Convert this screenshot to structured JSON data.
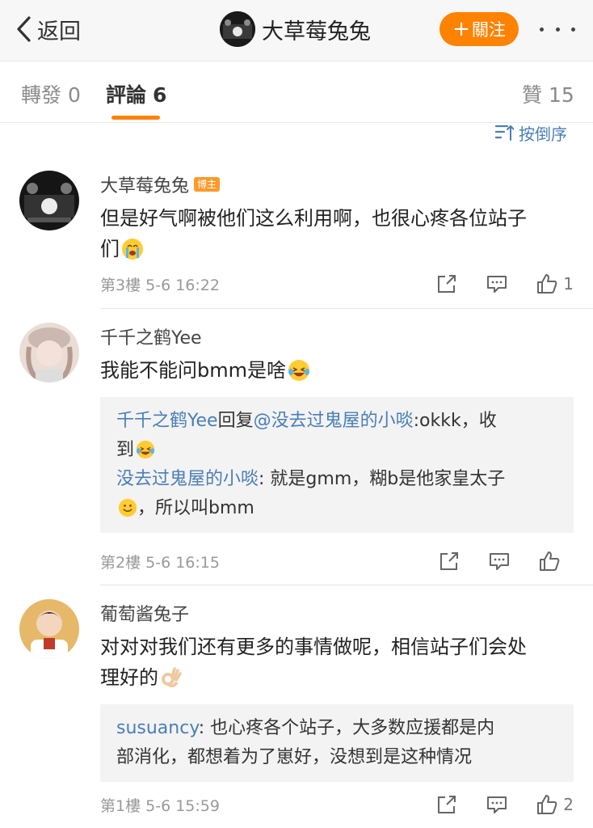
{
  "nav": {
    "back_label": "返回",
    "title": "大草莓兔兔",
    "follow_label": "關注"
  },
  "tabs": {
    "repost_label": "轉發",
    "repost_count": "0",
    "comments_label": "評論",
    "comments_count": "6",
    "likes_label": "贊",
    "likes_count": "15"
  },
  "sort_label": "按倒序",
  "comments": [
    {
      "name": "大草莓兔兔",
      "badge": "博主",
      "text_line1": "但是好气啊被他们这么利用啊，也很心疼各位站子",
      "text_line2": "们",
      "emoji": "crying-face-icon",
      "meta": "第3樓 5-6 16:22",
      "likes": "1"
    },
    {
      "name": "千千之鹤Yee",
      "text": "我能不能问bmm是啥",
      "emoji": "laughing-tears-icon",
      "replies": [
        {
          "name": "千千之鹤Yee",
          "reply_word": "回复",
          "mention": "@没去过鬼屋的小啖",
          "text_a": ":okkk，收",
          "text_b": "到"
        },
        {
          "name": "没去过鬼屋的小啖",
          "text_a": ": 就是gmm，糊b是他家皇太子",
          "text_b": "，所以叫bmm"
        }
      ],
      "meta": "第2樓 5-6 16:15",
      "likes": ""
    },
    {
      "name": "葡萄酱兔子",
      "text_line1": "对对对我们还有更多的事情做呢，相信站子们会处",
      "text_line2": "理好的",
      "emoji": "ok-hand-icon",
      "replies": [
        {
          "name": "susuancy",
          "text_a": ": 也心疼各个站子，大多数应援都是内",
          "text_b": "部消化，都想着为了崽好，没想到是这种情况"
        }
      ],
      "meta": "第1樓 5-6 15:59",
      "likes": "2"
    }
  ],
  "colors": {
    "accent": "#ff8200",
    "link": "#4a7eb6",
    "meta": "#999999"
  }
}
